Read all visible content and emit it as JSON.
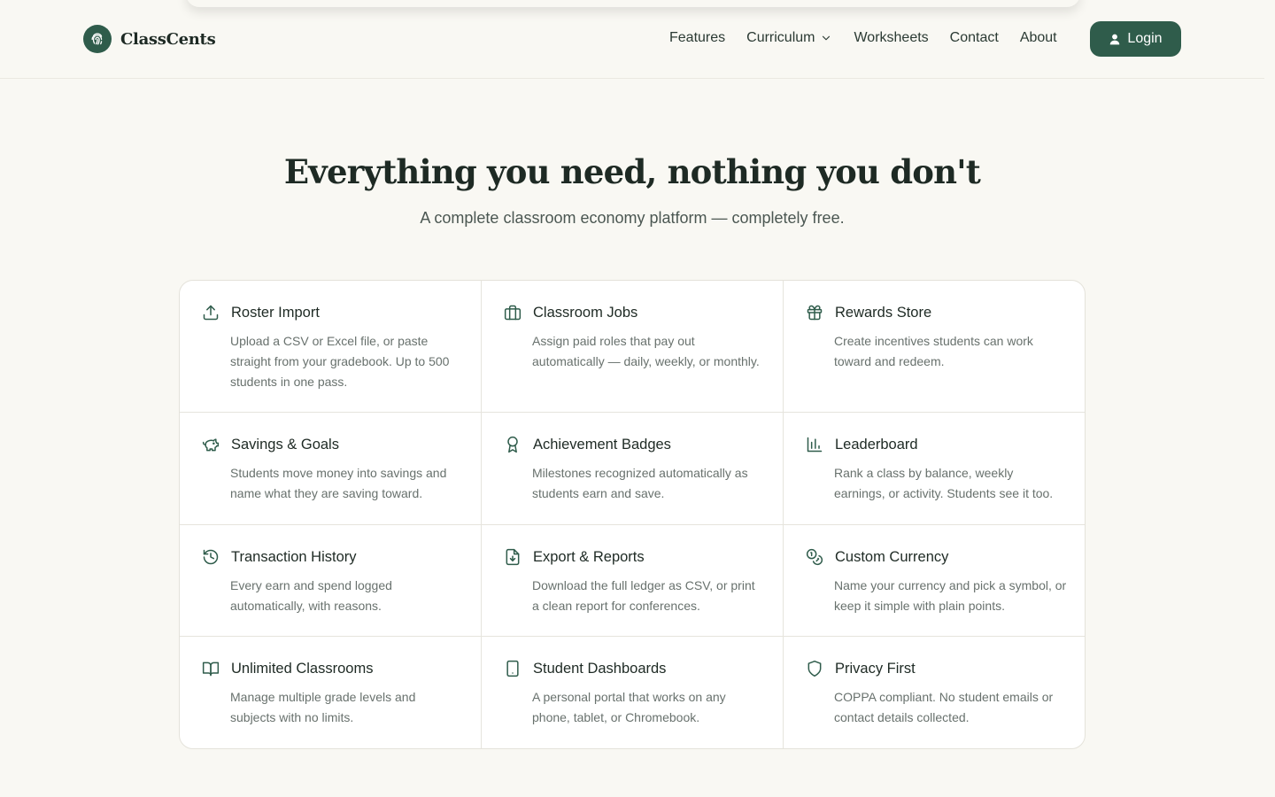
{
  "brand": {
    "name": "ClassCents",
    "logo_icon": "fingerprint-icon"
  },
  "nav": {
    "items": [
      {
        "label": "Features"
      },
      {
        "label": "Curriculum",
        "has_dropdown": true
      },
      {
        "label": "Worksheets"
      },
      {
        "label": "Contact"
      },
      {
        "label": "About"
      }
    ],
    "login_label": "Login"
  },
  "hero": {
    "title": "Everything you need, nothing you don't",
    "subtitle": "A complete classroom economy platform — completely free."
  },
  "features": [
    {
      "title": "Roster Import",
      "icon": "upload-icon",
      "description": "Upload a CSV or Excel file, or paste straight from your gradebook. Up to 500 students in one pass."
    },
    {
      "title": "Classroom Jobs",
      "icon": "briefcase-icon",
      "description": "Assign paid roles that pay out automatically — daily, weekly, or monthly."
    },
    {
      "title": "Rewards Store",
      "icon": "gift-icon",
      "description": "Create incentives students can work toward and redeem."
    },
    {
      "title": "Savings & Goals",
      "icon": "piggy-bank-icon",
      "description": "Students move money into savings and name what they are saving toward."
    },
    {
      "title": "Achievement Badges",
      "icon": "award-icon",
      "description": "Milestones recognized automatically as students earn and save."
    },
    {
      "title": "Leaderboard",
      "icon": "bar-chart-icon",
      "description": "Rank a class by balance, weekly earnings, or activity. Students see it too."
    },
    {
      "title": "Transaction History",
      "icon": "history-icon",
      "description": "Every earn and spend logged automatically, with reasons."
    },
    {
      "title": "Export & Reports",
      "icon": "file-download-icon",
      "description": "Download the full ledger as CSV, or print a clean report for conferences."
    },
    {
      "title": "Custom Currency",
      "icon": "coins-icon",
      "description": "Name your currency and pick a symbol, or keep it simple with plain points."
    },
    {
      "title": "Unlimited Classrooms",
      "icon": "book-open-icon",
      "description": "Manage multiple grade levels and subjects with no limits."
    },
    {
      "title": "Student Dashboards",
      "icon": "tablet-icon",
      "description": "A personal portal that works on any phone, tablet, or Chromebook."
    },
    {
      "title": "Privacy First",
      "icon": "shield-icon",
      "description": "COPPA compliant. No student emails or contact details collected."
    }
  ],
  "colors": {
    "accent": "#2f5c4b",
    "background": "#f9f8f3",
    "text": "#1e2a24",
    "muted": "#68716d"
  }
}
